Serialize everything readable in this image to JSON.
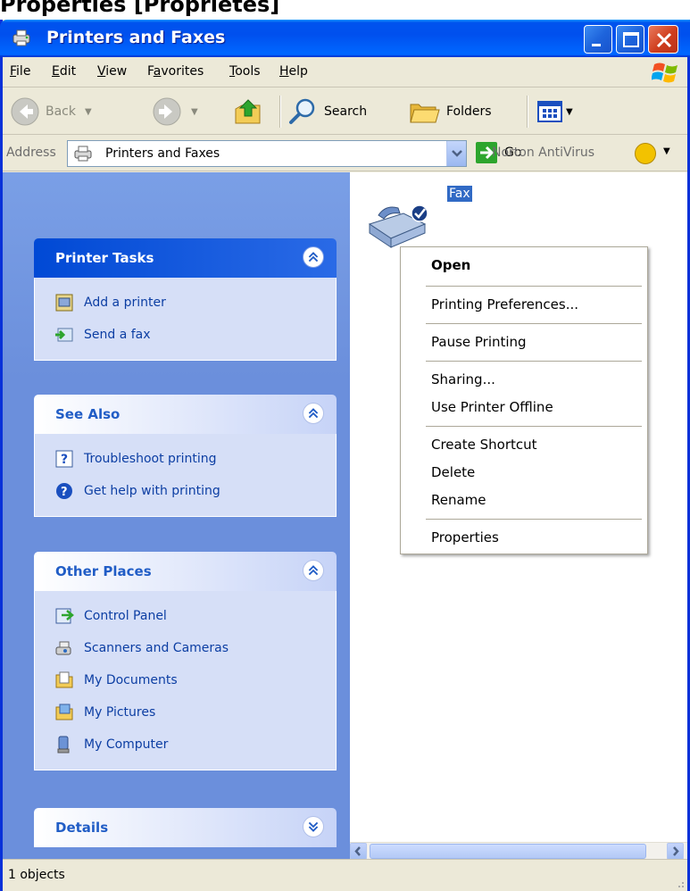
{
  "caption": "Properties [Propriétés]",
  "window": {
    "title": "Printers and Faxes"
  },
  "menubar": {
    "items": [
      "File",
      "Edit",
      "View",
      "Favorites",
      "Tools",
      "Help"
    ],
    "underline": [
      "F",
      "E",
      "V",
      "a",
      "T",
      "H"
    ]
  },
  "toolbar": {
    "back_label": "Back",
    "search_label": "Search",
    "folders_label": "Folders"
  },
  "address": {
    "label": "Address",
    "value": "Printers and Faxes",
    "go_label": "Go",
    "norton_label": "Norton AntiVirus"
  },
  "taskpane": {
    "panels": [
      {
        "title": "Printer Tasks",
        "items": [
          "Add a printer",
          "Send a fax"
        ]
      },
      {
        "title": "See Also",
        "items": [
          "Troubleshoot printing",
          "Get help with printing"
        ]
      },
      {
        "title": "Other Places",
        "items": [
          "Control Panel",
          "Scanners and Cameras",
          "My Documents",
          "My Pictures",
          "My Computer"
        ]
      },
      {
        "title": "Details",
        "items": []
      }
    ]
  },
  "content": {
    "item_label": "Fax"
  },
  "context_menu": {
    "items": [
      "Open",
      "Printing Preferences...",
      "Pause Printing",
      "Sharing...",
      "Use Printer Offline",
      "Create Shortcut",
      "Delete",
      "Rename",
      "Properties"
    ]
  },
  "status": {
    "text": "1 objects"
  },
  "colors": {
    "titlebar": "#0053ee",
    "taskpane": "#6b8fdc",
    "selection": "#316ac5",
    "link": "#0c3ea3"
  }
}
